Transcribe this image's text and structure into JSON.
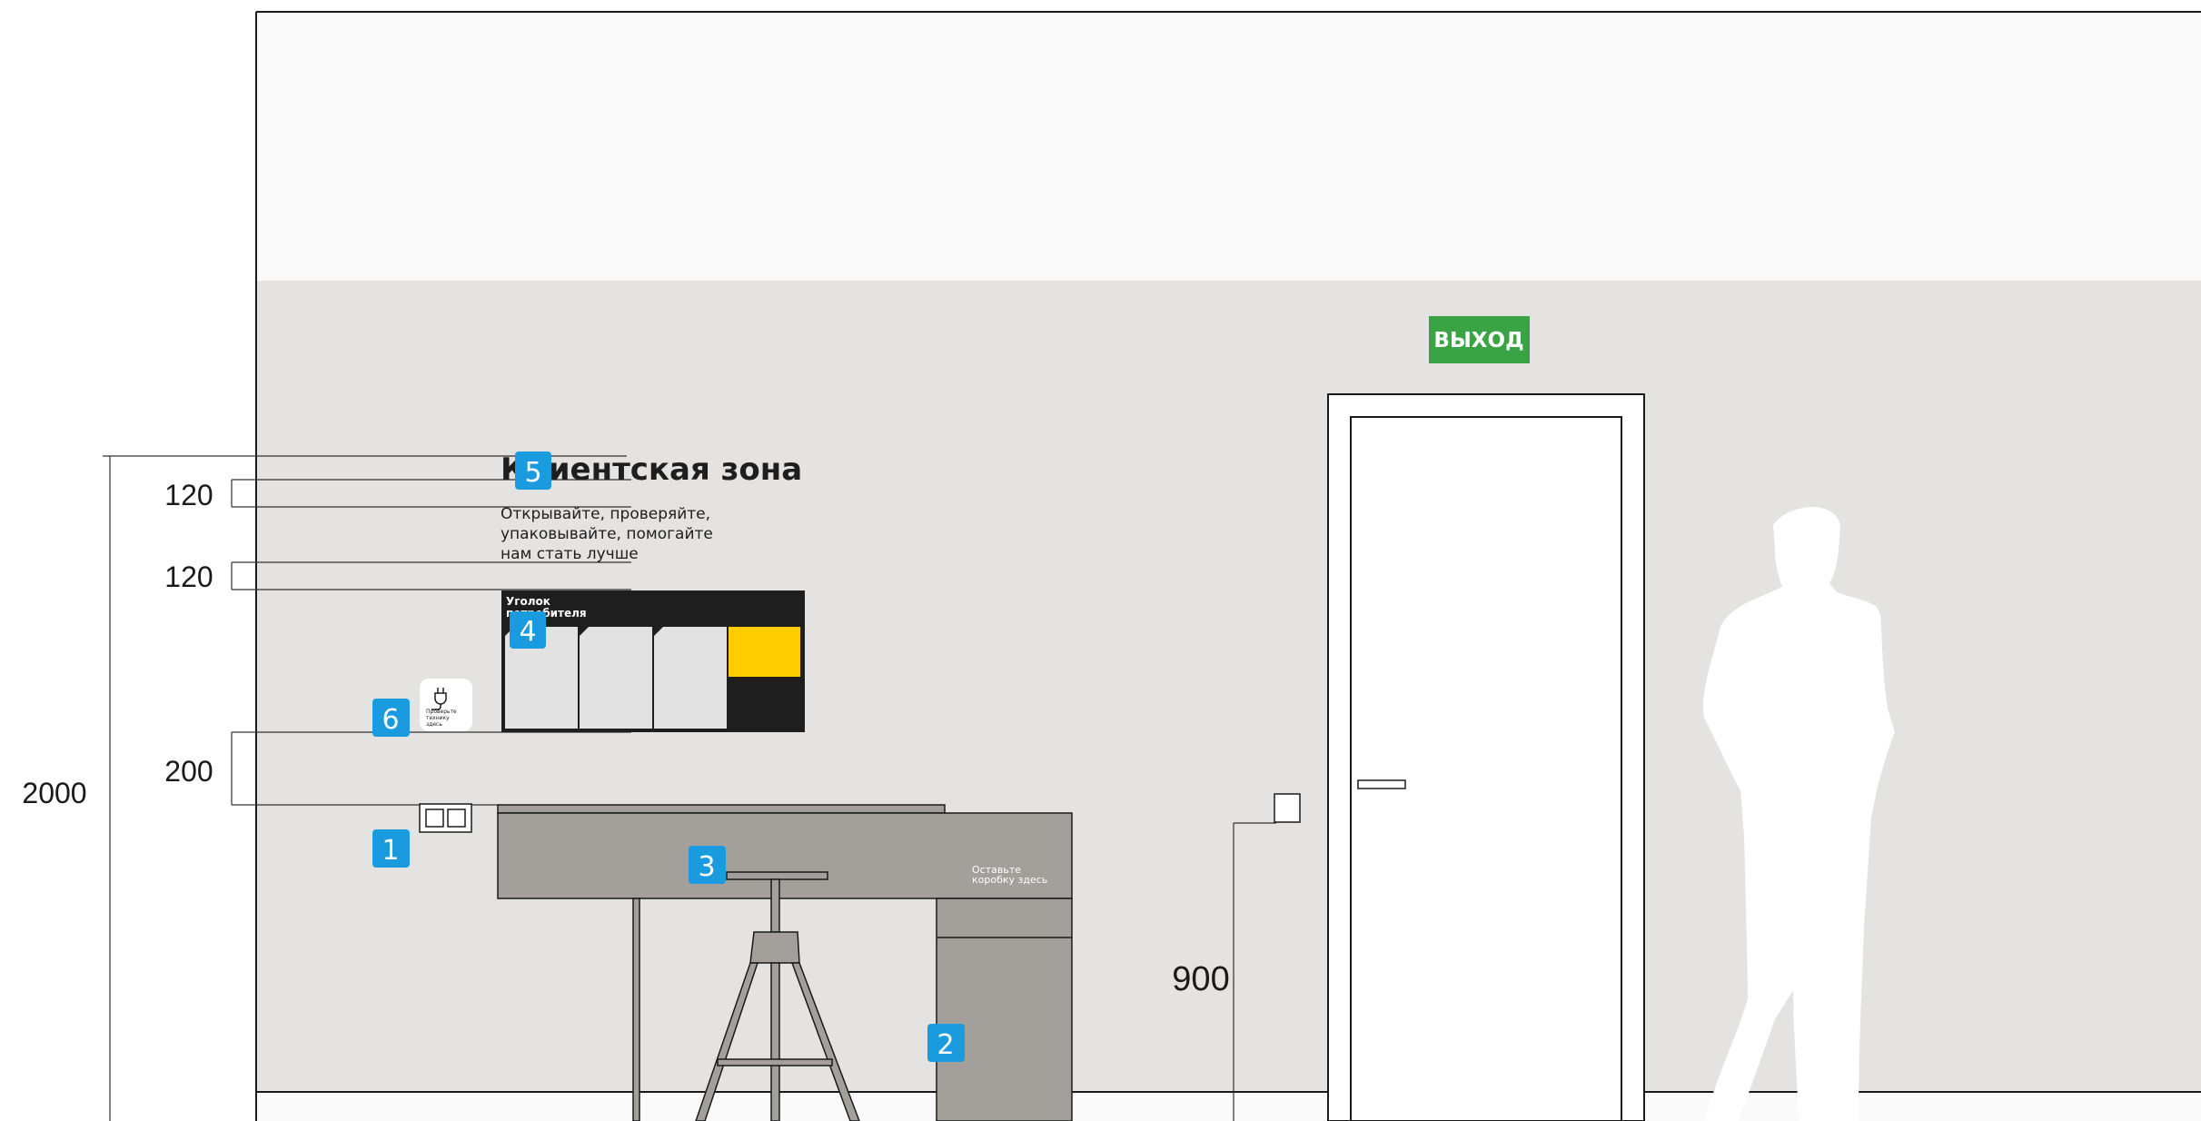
{
  "colors": {
    "wall": "#e4e3e2",
    "ceiling": "#fafafa",
    "furniture": "#a39f9b",
    "board": "#1e1e1e",
    "accent_yellow": "#ffcc00",
    "badge_blue": "#1a9be0",
    "exit_green": "#3aa444",
    "line": "#1a1a1a"
  },
  "dimensions": {
    "total_height": "2000",
    "gap_1": "120",
    "gap_2": "120",
    "gap_3": "200",
    "switch_height": "900"
  },
  "markers": {
    "m1": "1",
    "m2": "2",
    "m3": "3",
    "m4": "4",
    "m5": "5",
    "m6": "6"
  },
  "sign": {
    "title": "Клиентская зона",
    "line1": "Открывайте, проверяйте,",
    "line2": "упаковывайте, помогайте",
    "line3": "нам стать лучше"
  },
  "board": {
    "label_line1": "Уголок",
    "label_line2": "потребителя"
  },
  "plug_sign": {
    "icon": "plug-icon",
    "line1": "Проверьте",
    "line2": "технику",
    "line3": "здесь"
  },
  "counter": {
    "label_line1": "Оставьте",
    "label_line2": "коробку здесь"
  },
  "exit_sign": {
    "text": "ВЫХОД"
  }
}
